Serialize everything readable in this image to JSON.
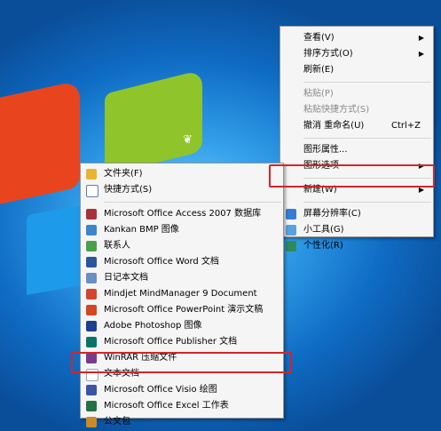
{
  "context_menu": {
    "items": [
      {
        "label": "查看(V)"
      },
      {
        "label": "排序方式(O)"
      },
      {
        "label": "刷新(E)"
      },
      {
        "label": "粘贴(P)"
      },
      {
        "label": "粘贴快捷方式(S)"
      },
      {
        "label": "撤消 重命名(U)",
        "shortcut": "Ctrl+Z"
      },
      {
        "label": "图形属性..."
      },
      {
        "label": "图形选项"
      },
      {
        "label": "新建(W)"
      },
      {
        "label": "屏幕分辨率(C)"
      },
      {
        "label": "小工具(G)"
      },
      {
        "label": "个性化(R)"
      }
    ]
  },
  "new_submenu": {
    "items": [
      {
        "label": "文件夹(F)",
        "icon": "folder-icon",
        "color": "#e8b531"
      },
      {
        "label": "快捷方式(S)",
        "icon": "shortcut-icon",
        "color": "#5a7fb3"
      },
      {
        "label": "Microsoft Office Access 2007 数据库",
        "icon": "access-icon",
        "color": "#a8323a"
      },
      {
        "label": "Kankan BMP 图像",
        "icon": "bmp-image-icon",
        "color": "#3a86c8"
      },
      {
        "label": "联系人",
        "icon": "contact-icon",
        "color": "#4aa04a"
      },
      {
        "label": "Microsoft Office Word 文档",
        "icon": "word-icon",
        "color": "#2b579a"
      },
      {
        "label": "日记本文档",
        "icon": "journal-icon",
        "color": "#6b8fc0"
      },
      {
        "label": "Mindjet MindManager 9 Document",
        "icon": "mindmanager-icon",
        "color": "#d2452c"
      },
      {
        "label": "Microsoft Office PowerPoint 演示文稿",
        "icon": "powerpoint-icon",
        "color": "#d24726"
      },
      {
        "label": "Adobe Photoshop 图像",
        "icon": "photoshop-icon",
        "color": "#1c3f8e"
      },
      {
        "label": "Microsoft Office Publisher 文档",
        "icon": "publisher-icon",
        "color": "#077568"
      },
      {
        "label": "WinRAR 压缩文件",
        "icon": "winrar-icon",
        "color": "#7a3b8c"
      },
      {
        "label": "文本文档",
        "icon": "text-document-icon",
        "color": "#ffffff"
      },
      {
        "label": "Microsoft Office Visio 绘图",
        "icon": "visio-icon",
        "color": "#3955a3"
      },
      {
        "label": "Microsoft Office Excel 工作表",
        "icon": "excel-icon",
        "color": "#217346"
      },
      {
        "label": "公文包",
        "icon": "briefcase-icon",
        "color": "#c98a2a"
      }
    ]
  },
  "colors": {
    "highlight_box": "#d0262c",
    "menu_bg": "#f5f5f5"
  }
}
